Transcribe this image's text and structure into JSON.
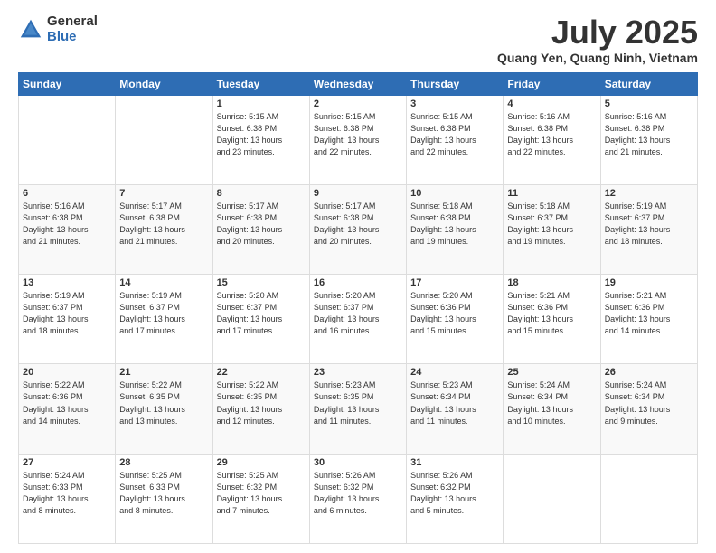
{
  "header": {
    "logo_general": "General",
    "logo_blue": "Blue",
    "month_year": "July 2025",
    "location": "Quang Yen, Quang Ninh, Vietnam"
  },
  "weekdays": [
    "Sunday",
    "Monday",
    "Tuesday",
    "Wednesday",
    "Thursday",
    "Friday",
    "Saturday"
  ],
  "weeks": [
    [
      {
        "day": "",
        "info": ""
      },
      {
        "day": "",
        "info": ""
      },
      {
        "day": "1",
        "info": "Sunrise: 5:15 AM\nSunset: 6:38 PM\nDaylight: 13 hours\nand 23 minutes."
      },
      {
        "day": "2",
        "info": "Sunrise: 5:15 AM\nSunset: 6:38 PM\nDaylight: 13 hours\nand 22 minutes."
      },
      {
        "day": "3",
        "info": "Sunrise: 5:15 AM\nSunset: 6:38 PM\nDaylight: 13 hours\nand 22 minutes."
      },
      {
        "day": "4",
        "info": "Sunrise: 5:16 AM\nSunset: 6:38 PM\nDaylight: 13 hours\nand 22 minutes."
      },
      {
        "day": "5",
        "info": "Sunrise: 5:16 AM\nSunset: 6:38 PM\nDaylight: 13 hours\nand 21 minutes."
      }
    ],
    [
      {
        "day": "6",
        "info": "Sunrise: 5:16 AM\nSunset: 6:38 PM\nDaylight: 13 hours\nand 21 minutes."
      },
      {
        "day": "7",
        "info": "Sunrise: 5:17 AM\nSunset: 6:38 PM\nDaylight: 13 hours\nand 21 minutes."
      },
      {
        "day": "8",
        "info": "Sunrise: 5:17 AM\nSunset: 6:38 PM\nDaylight: 13 hours\nand 20 minutes."
      },
      {
        "day": "9",
        "info": "Sunrise: 5:17 AM\nSunset: 6:38 PM\nDaylight: 13 hours\nand 20 minutes."
      },
      {
        "day": "10",
        "info": "Sunrise: 5:18 AM\nSunset: 6:38 PM\nDaylight: 13 hours\nand 19 minutes."
      },
      {
        "day": "11",
        "info": "Sunrise: 5:18 AM\nSunset: 6:37 PM\nDaylight: 13 hours\nand 19 minutes."
      },
      {
        "day": "12",
        "info": "Sunrise: 5:19 AM\nSunset: 6:37 PM\nDaylight: 13 hours\nand 18 minutes."
      }
    ],
    [
      {
        "day": "13",
        "info": "Sunrise: 5:19 AM\nSunset: 6:37 PM\nDaylight: 13 hours\nand 18 minutes."
      },
      {
        "day": "14",
        "info": "Sunrise: 5:19 AM\nSunset: 6:37 PM\nDaylight: 13 hours\nand 17 minutes."
      },
      {
        "day": "15",
        "info": "Sunrise: 5:20 AM\nSunset: 6:37 PM\nDaylight: 13 hours\nand 17 minutes."
      },
      {
        "day": "16",
        "info": "Sunrise: 5:20 AM\nSunset: 6:37 PM\nDaylight: 13 hours\nand 16 minutes."
      },
      {
        "day": "17",
        "info": "Sunrise: 5:20 AM\nSunset: 6:36 PM\nDaylight: 13 hours\nand 15 minutes."
      },
      {
        "day": "18",
        "info": "Sunrise: 5:21 AM\nSunset: 6:36 PM\nDaylight: 13 hours\nand 15 minutes."
      },
      {
        "day": "19",
        "info": "Sunrise: 5:21 AM\nSunset: 6:36 PM\nDaylight: 13 hours\nand 14 minutes."
      }
    ],
    [
      {
        "day": "20",
        "info": "Sunrise: 5:22 AM\nSunset: 6:36 PM\nDaylight: 13 hours\nand 14 minutes."
      },
      {
        "day": "21",
        "info": "Sunrise: 5:22 AM\nSunset: 6:35 PM\nDaylight: 13 hours\nand 13 minutes."
      },
      {
        "day": "22",
        "info": "Sunrise: 5:22 AM\nSunset: 6:35 PM\nDaylight: 13 hours\nand 12 minutes."
      },
      {
        "day": "23",
        "info": "Sunrise: 5:23 AM\nSunset: 6:35 PM\nDaylight: 13 hours\nand 11 minutes."
      },
      {
        "day": "24",
        "info": "Sunrise: 5:23 AM\nSunset: 6:34 PM\nDaylight: 13 hours\nand 11 minutes."
      },
      {
        "day": "25",
        "info": "Sunrise: 5:24 AM\nSunset: 6:34 PM\nDaylight: 13 hours\nand 10 minutes."
      },
      {
        "day": "26",
        "info": "Sunrise: 5:24 AM\nSunset: 6:34 PM\nDaylight: 13 hours\nand 9 minutes."
      }
    ],
    [
      {
        "day": "27",
        "info": "Sunrise: 5:24 AM\nSunset: 6:33 PM\nDaylight: 13 hours\nand 8 minutes."
      },
      {
        "day": "28",
        "info": "Sunrise: 5:25 AM\nSunset: 6:33 PM\nDaylight: 13 hours\nand 8 minutes."
      },
      {
        "day": "29",
        "info": "Sunrise: 5:25 AM\nSunset: 6:32 PM\nDaylight: 13 hours\nand 7 minutes."
      },
      {
        "day": "30",
        "info": "Sunrise: 5:26 AM\nSunset: 6:32 PM\nDaylight: 13 hours\nand 6 minutes."
      },
      {
        "day": "31",
        "info": "Sunrise: 5:26 AM\nSunset: 6:32 PM\nDaylight: 13 hours\nand 5 minutes."
      },
      {
        "day": "",
        "info": ""
      },
      {
        "day": "",
        "info": ""
      }
    ]
  ]
}
